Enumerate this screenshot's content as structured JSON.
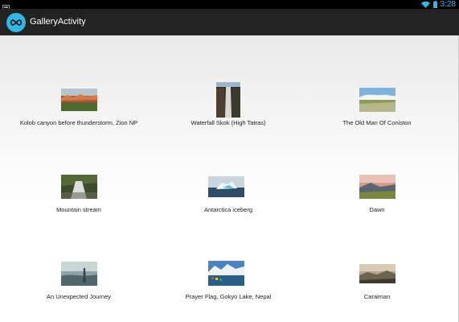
{
  "status_bar": {
    "time": "3:28",
    "icons": [
      "notification-icon",
      "wifi-icon",
      "battery-icon"
    ],
    "accent": "#33b5e5"
  },
  "action_bar": {
    "title": "GalleryActivity",
    "icon": "infinity-icon",
    "background": "#222222"
  },
  "gallery": {
    "items": [
      {
        "caption": "Kolob canyon before thunderstorm, Zion NP"
      },
      {
        "caption": "Waterfall Skok (High Tatras)"
      },
      {
        "caption": "The Old Man Of Coniston"
      },
      {
        "caption": "Mountain stream"
      },
      {
        "caption": "Antarctica iceberg"
      },
      {
        "caption": "Dawn"
      },
      {
        "caption": "An Unexpected Journey"
      },
      {
        "caption": "Prayer Flag, Gokyo Lake, Nepal"
      },
      {
        "caption": "Caraiman"
      }
    ]
  }
}
